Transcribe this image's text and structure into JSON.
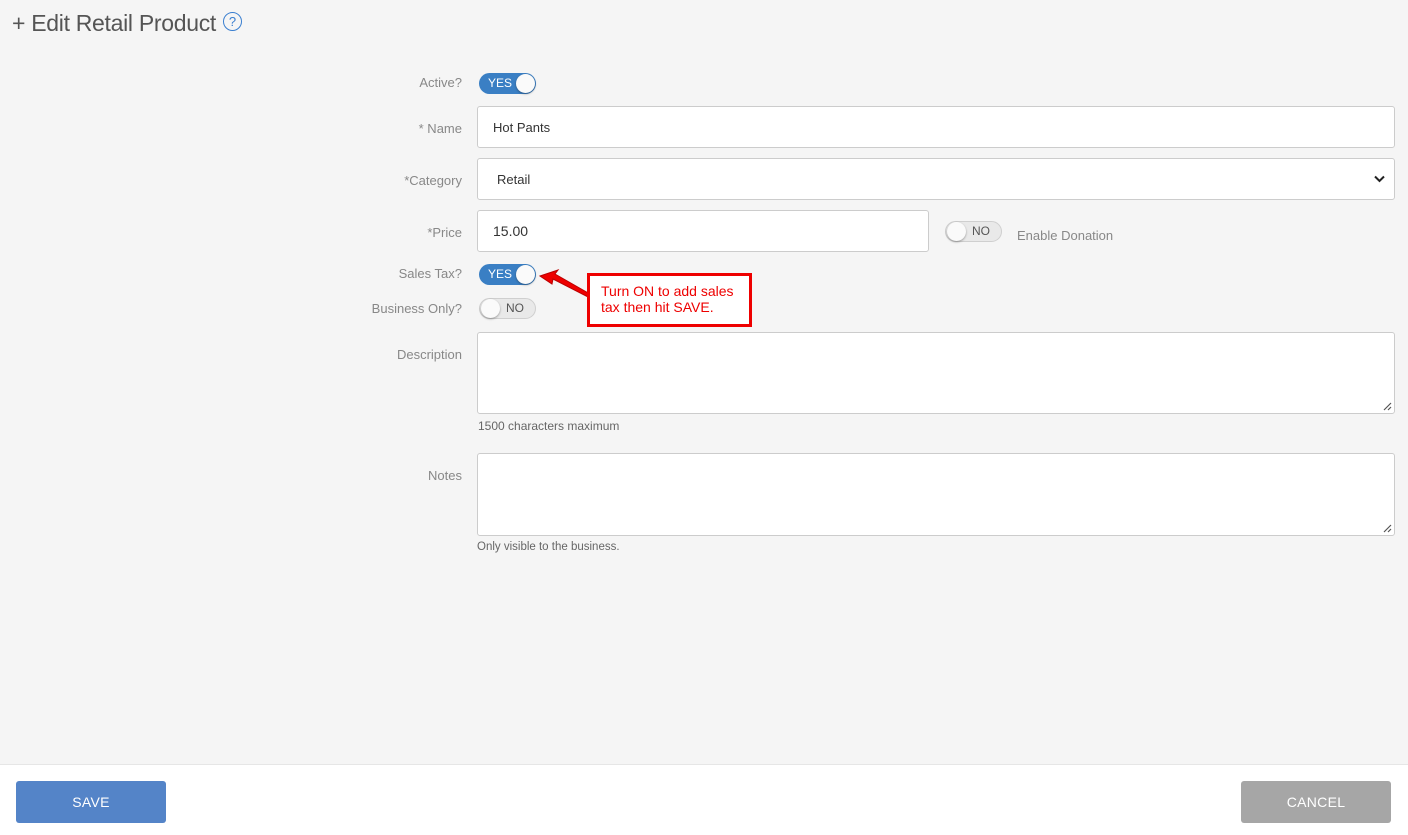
{
  "header": {
    "title": "+ Edit Retail Product",
    "help_icon": "question-circle-icon"
  },
  "form": {
    "active": {
      "label": "Active?",
      "toggle": "YES"
    },
    "name": {
      "label": "* Name",
      "value": "Hot Pants"
    },
    "category": {
      "label": "*Category",
      "value": "Retail",
      "icon": "chevron-down-icon"
    },
    "price": {
      "label": "*Price",
      "value": "15.00"
    },
    "donation": {
      "toggle": "NO",
      "label": "Enable Donation"
    },
    "sales_tax": {
      "label": "Sales Tax?",
      "toggle": "YES"
    },
    "business_only": {
      "label": "Business Only?",
      "toggle": "NO"
    },
    "description": {
      "label": "Description",
      "value": "",
      "hint": "1500 characters maximum"
    },
    "notes": {
      "label": "Notes",
      "value": "",
      "hint": "Only visible to the business."
    }
  },
  "annotation": {
    "line1": "Turn ON to add sales",
    "line2": "tax then hit SAVE.",
    "color": "#ee0000"
  },
  "footer": {
    "save_label": "SAVE",
    "cancel_label": "CANCEL"
  },
  "colors": {
    "toggle_on": "#3a7fc4",
    "save": "#5484c8",
    "cancel": "#a6a6a6",
    "accent": "#3a7fd0"
  }
}
